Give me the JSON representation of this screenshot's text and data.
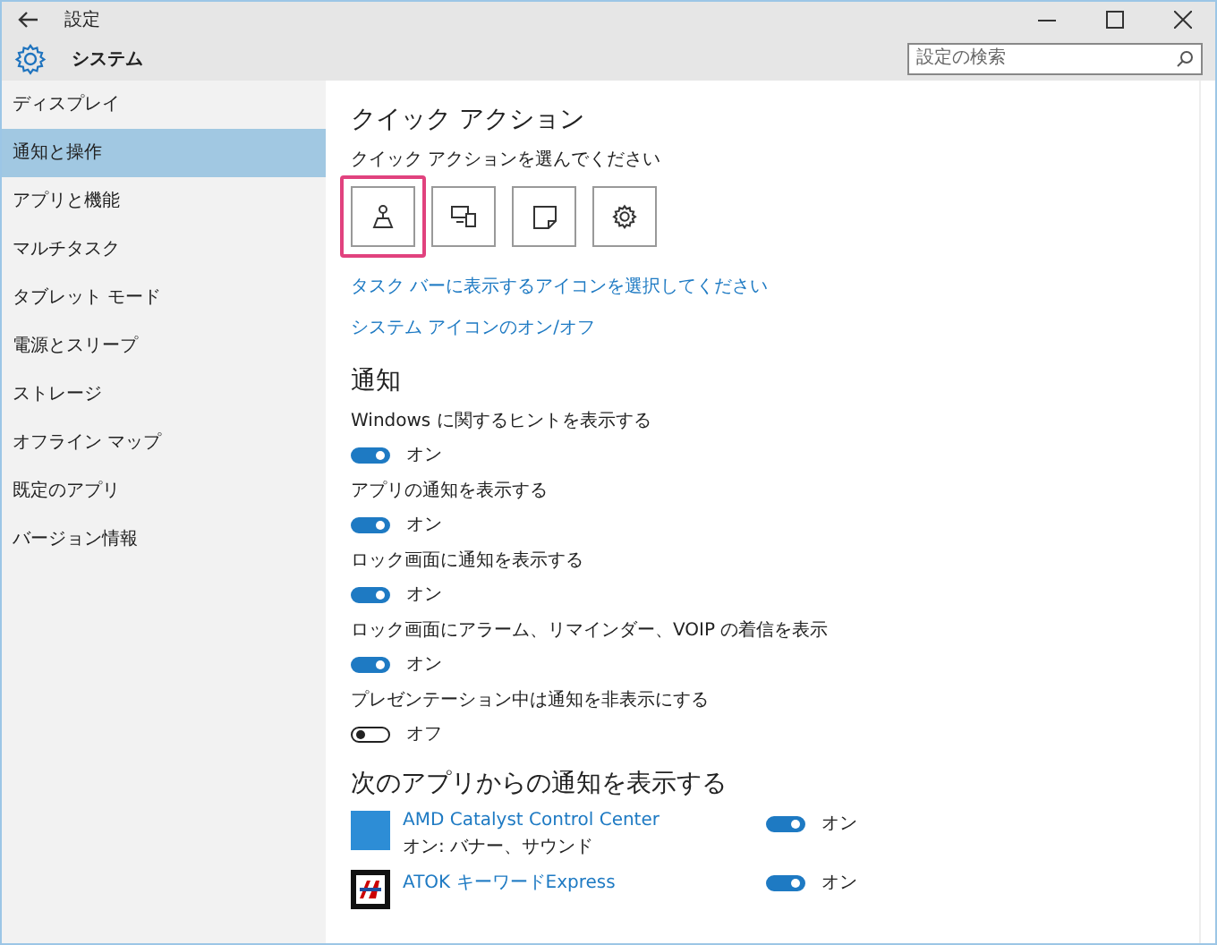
{
  "window": {
    "title": "設定"
  },
  "header": {
    "title": "システム",
    "search": {
      "placeholder": "設定の検索"
    }
  },
  "sidebar": {
    "items": [
      {
        "label": "ディスプレイ",
        "selected": false
      },
      {
        "label": "通知と操作",
        "selected": true
      },
      {
        "label": "アプリと機能",
        "selected": false
      },
      {
        "label": "マルチタスク",
        "selected": false
      },
      {
        "label": "タブレット モード",
        "selected": false
      },
      {
        "label": "電源とスリープ",
        "selected": false
      },
      {
        "label": "ストレージ",
        "selected": false
      },
      {
        "label": "オフライン マップ",
        "selected": false
      },
      {
        "label": "既定のアプリ",
        "selected": false
      },
      {
        "label": "バージョン情報",
        "selected": false
      }
    ]
  },
  "quick_actions": {
    "heading": "クイック アクション",
    "subtitle": "クイック アクションを選んでください",
    "tiles": [
      {
        "kind": "tablet",
        "selected": true
      },
      {
        "kind": "connect",
        "selected": false
      },
      {
        "kind": "note",
        "selected": false
      },
      {
        "kind": "settings",
        "selected": false
      }
    ],
    "links": [
      "タスク バーに表示するアイコンを選択してください",
      "システム アイコンのオン/オフ"
    ]
  },
  "notifications": {
    "heading": "通知",
    "settings": [
      {
        "label": "Windows に関するヒントを表示する",
        "on": true,
        "state": "オン"
      },
      {
        "label": "アプリの通知を表示する",
        "on": true,
        "state": "オン"
      },
      {
        "label": "ロック画面に通知を表示する",
        "on": true,
        "state": "オン"
      },
      {
        "label": "ロック画面にアラーム、リマインダー、VOIP の着信を表示",
        "on": true,
        "state": "オン"
      },
      {
        "label": "プレゼンテーション中は通知を非表示にする",
        "on": false,
        "state": "オフ"
      }
    ]
  },
  "apps": {
    "heading": "次のアプリからの通知を表示する",
    "items": [
      {
        "name": "AMD Catalyst Control Center",
        "detail": "オン: バナー、サウンド",
        "on": true,
        "state": "オン"
      },
      {
        "name": "ATOK キーワードExpress",
        "on": true,
        "state": "オン"
      }
    ]
  }
}
